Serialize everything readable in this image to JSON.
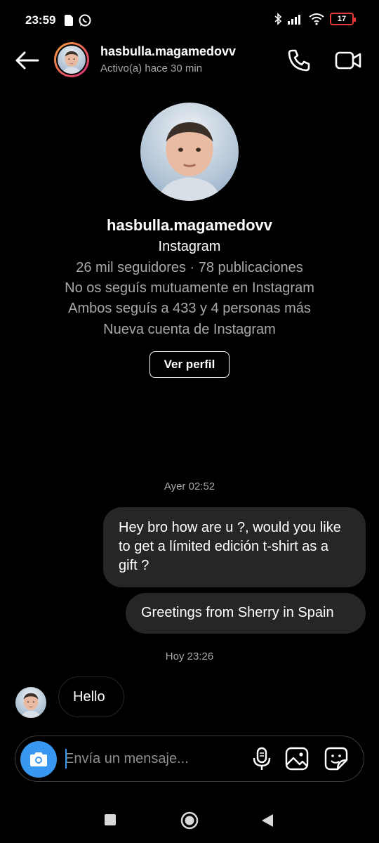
{
  "status_bar": {
    "time": "23:59",
    "battery": "17"
  },
  "header": {
    "username": "hasbulla.magamedovv",
    "activity": "Activo(a) hace 30 min"
  },
  "profile": {
    "username": "hasbulla.magamedovv",
    "platform": "Instagram",
    "stats": "26 mil seguidores · 78 publicaciones",
    "mutual": "No os seguís mutuamente en Instagram",
    "following": "Ambos seguís a 433 y 4 personas más",
    "new_account": "Nueva cuenta de Instagram",
    "view_profile_label": "Ver perfil"
  },
  "messages": {
    "timestamp_1": "Ayer 02:52",
    "outgoing_1": "Hey bro how are u ?, would you like to get a límited edición t-shirt as a gift ?",
    "outgoing_2": "Greetings from Sherry in Spain",
    "timestamp_2": "Hoy 23:26",
    "incoming_1": "Hello"
  },
  "composer": {
    "placeholder": "Envía un mensaje..."
  },
  "colors": {
    "accent": "#3897f0",
    "bubble": "#262626",
    "battery_low": "#e53935"
  }
}
